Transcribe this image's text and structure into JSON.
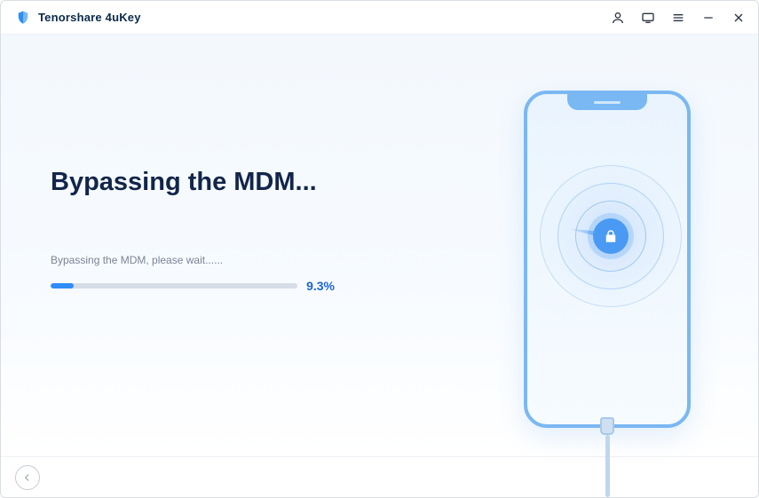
{
  "app": {
    "title": "Tenorshare 4uKey"
  },
  "main": {
    "heading": "Bypassing the MDM...",
    "status": "Bypassing the MDM, please wait......",
    "progress": {
      "percent": 9.3,
      "label": "9.3%"
    }
  },
  "colors": {
    "accent": "#2e8df7",
    "heading": "#12254a"
  },
  "icons": {
    "logo": "shield-logo",
    "controls": [
      "account",
      "feedback",
      "menu",
      "minimize",
      "close"
    ],
    "phone_center": "lock",
    "footer_back": "arrow-left"
  }
}
